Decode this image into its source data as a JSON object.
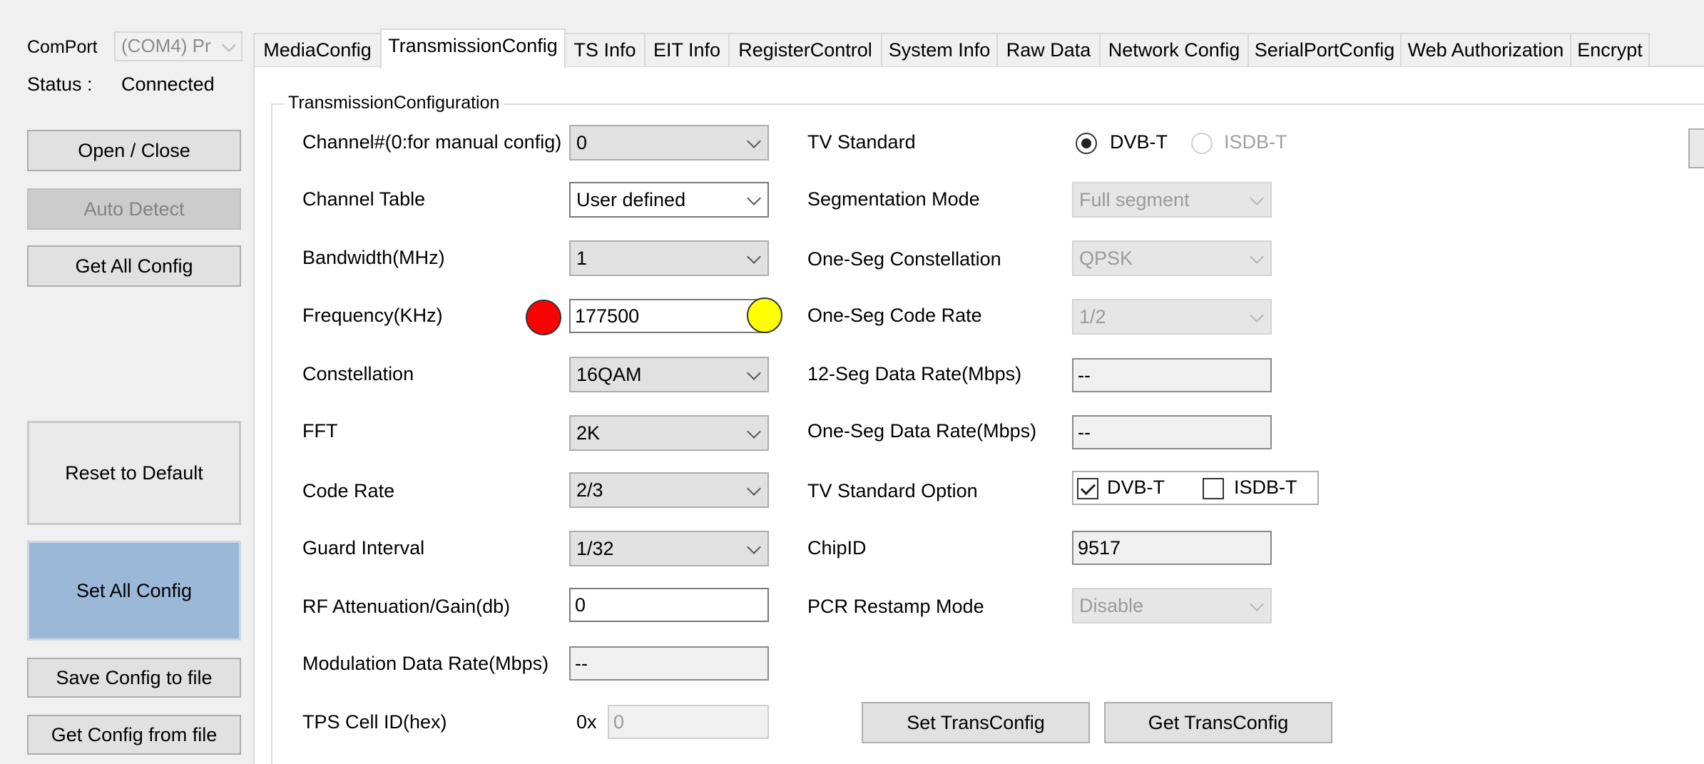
{
  "left_panel": {
    "comport_label": "ComPort",
    "comport_value": "(COM4) Pr",
    "status_label": "Status :",
    "status_value": "Connected",
    "buttons": {
      "open_close": "Open / Close",
      "auto_detect": "Auto Detect",
      "get_all_config": "Get All Config",
      "reset_default": "Reset to Default",
      "set_all_config": "Set All Config",
      "save_config": "Save Config to file",
      "get_config_file": "Get Config from file"
    }
  },
  "tabs": [
    {
      "label": "MediaConfig"
    },
    {
      "label": "TransmissionConfig"
    },
    {
      "label": "TS Info"
    },
    {
      "label": "EIT Info"
    },
    {
      "label": "RegisterControl"
    },
    {
      "label": "System Info"
    },
    {
      "label": "Raw Data"
    },
    {
      "label": "Network Config"
    },
    {
      "label": "SerialPortConfig"
    },
    {
      "label": "Web Authorization"
    },
    {
      "label": "Encrypt"
    }
  ],
  "group_title": "TransmissionConfiguration",
  "left_fields": {
    "channel": {
      "label": "Channel#(0:for manual config)",
      "value": "0"
    },
    "channel_table": {
      "label": "Channel Table",
      "value": "User defined"
    },
    "bandwidth": {
      "label": "Bandwidth(MHz)",
      "value": "1"
    },
    "frequency": {
      "label": "Frequency(KHz)",
      "value": "177500"
    },
    "constellation": {
      "label": "Constellation",
      "value": "16QAM"
    },
    "fft": {
      "label": "FFT",
      "value": "2K"
    },
    "code_rate": {
      "label": "Code Rate",
      "value": "2/3"
    },
    "guard_interval": {
      "label": "Guard Interval",
      "value": "1/32"
    },
    "rf_atten": {
      "label": "RF Attenuation/Gain(db)",
      "value": "0"
    },
    "mod_rate": {
      "label": "Modulation Data Rate(Mbps)",
      "value": "--"
    },
    "tps_cell": {
      "label": "TPS Cell ID(hex)",
      "prefix": "0x",
      "value": "0"
    }
  },
  "right_fields": {
    "tv_standard": {
      "label": "TV Standard",
      "opt1": "DVB-T",
      "opt2": "ISDB-T"
    },
    "segmentation": {
      "label": "Segmentation Mode",
      "value": "Full segment"
    },
    "oneseg_const": {
      "label": "One-Seg Constellation",
      "value": "QPSK"
    },
    "oneseg_rate": {
      "label": "One-Seg Code Rate",
      "value": "1/2"
    },
    "seg12_rate": {
      "label": "12-Seg Data Rate(Mbps)",
      "value": "--"
    },
    "oneseg_data_rate": {
      "label": "One-Seg Data Rate(Mbps)",
      "value": "--"
    },
    "tv_std_option": {
      "label": "TV Standard Option",
      "opt1": "DVB-T",
      "opt2": "ISDB-T"
    },
    "chip_id": {
      "label": "ChipID",
      "value": "9517"
    },
    "pcr_restamp": {
      "label": "PCR Restamp Mode",
      "value": "Disable"
    }
  },
  "actions": {
    "set_trans": "Set TransConfig",
    "get_trans": "Get TransConfig"
  },
  "colors": {
    "marker_red": "#ff0000",
    "marker_yellow": "#ffff00",
    "set_all_bg": "#9cb8d8"
  }
}
